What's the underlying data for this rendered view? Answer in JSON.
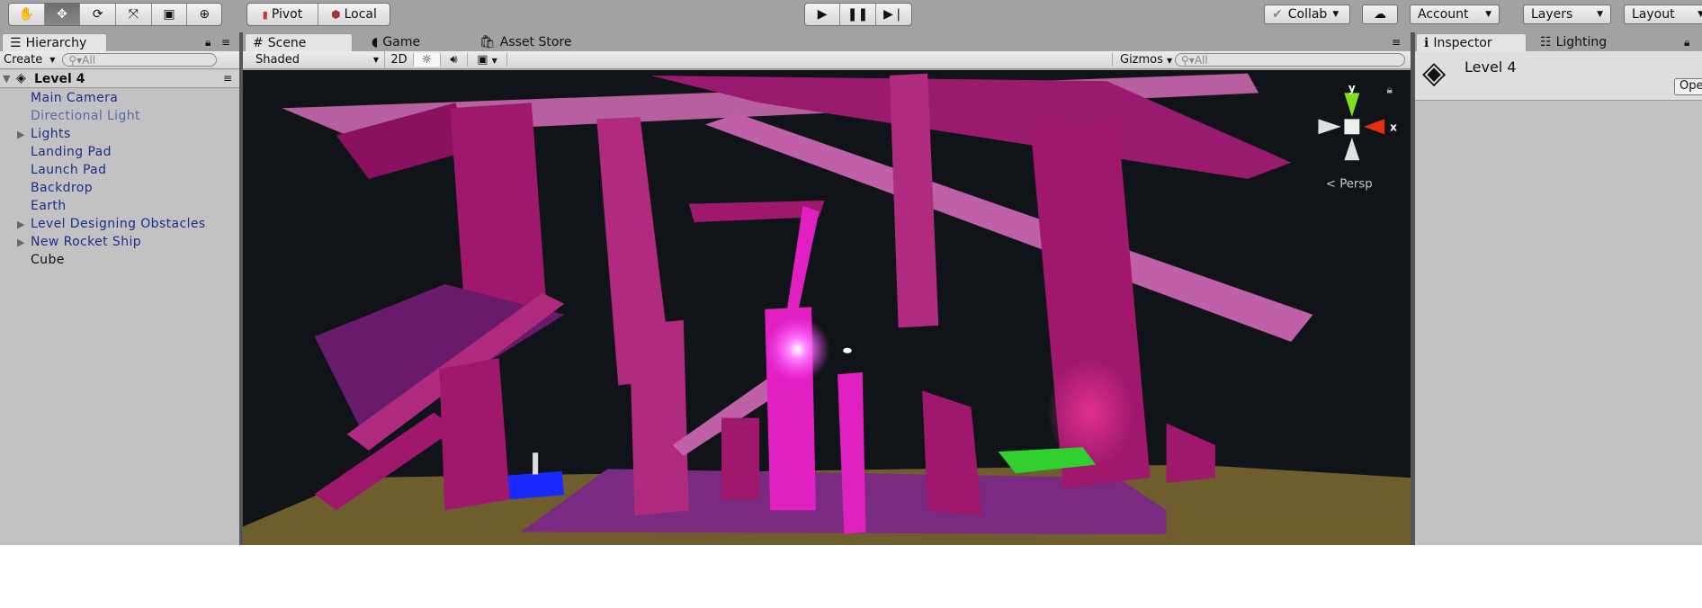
{
  "toolbar": {
    "tools": [
      "hand-tool",
      "move-tool",
      "rotate-tool",
      "scale-tool",
      "rect-tool",
      "transform-tool"
    ],
    "pivot": "Pivot",
    "local": "Local",
    "collab": "Collab",
    "account": "Account",
    "layers": "Layers",
    "layout": "Layout"
  },
  "hierarchy": {
    "tab": "Hierarchy",
    "create": "Create",
    "search_placeholder": "All",
    "scene": "Level 4",
    "items": [
      {
        "label": "Main Camera"
      },
      {
        "label": "Directional Light"
      },
      {
        "label": "Lights"
      },
      {
        "label": "Landing Pad"
      },
      {
        "label": "Launch Pad"
      },
      {
        "label": "Backdrop"
      },
      {
        "label": "Earth"
      },
      {
        "label": "Level Designing Obstacles"
      },
      {
        "label": "New Rocket Ship"
      },
      {
        "label": "Cube"
      }
    ]
  },
  "scene": {
    "tabs": [
      "Scene",
      "Game",
      "Asset Store"
    ],
    "shading": "Shaded",
    "mode2d": "2D",
    "gizmos": "Gizmos",
    "search_placeholder": "All",
    "persp": "Persp",
    "axis_y": "y",
    "axis_x": "x"
  },
  "inspector": {
    "tabs": [
      "Inspector",
      "Lighting"
    ],
    "object": "Level 4",
    "open": "Ope"
  },
  "colors": {
    "scene_bg": "#101418",
    "obstacle": "#a0186e",
    "glow": "#e020c0",
    "launch_pad": "#1a2aff",
    "landing_pad": "#30d030"
  }
}
